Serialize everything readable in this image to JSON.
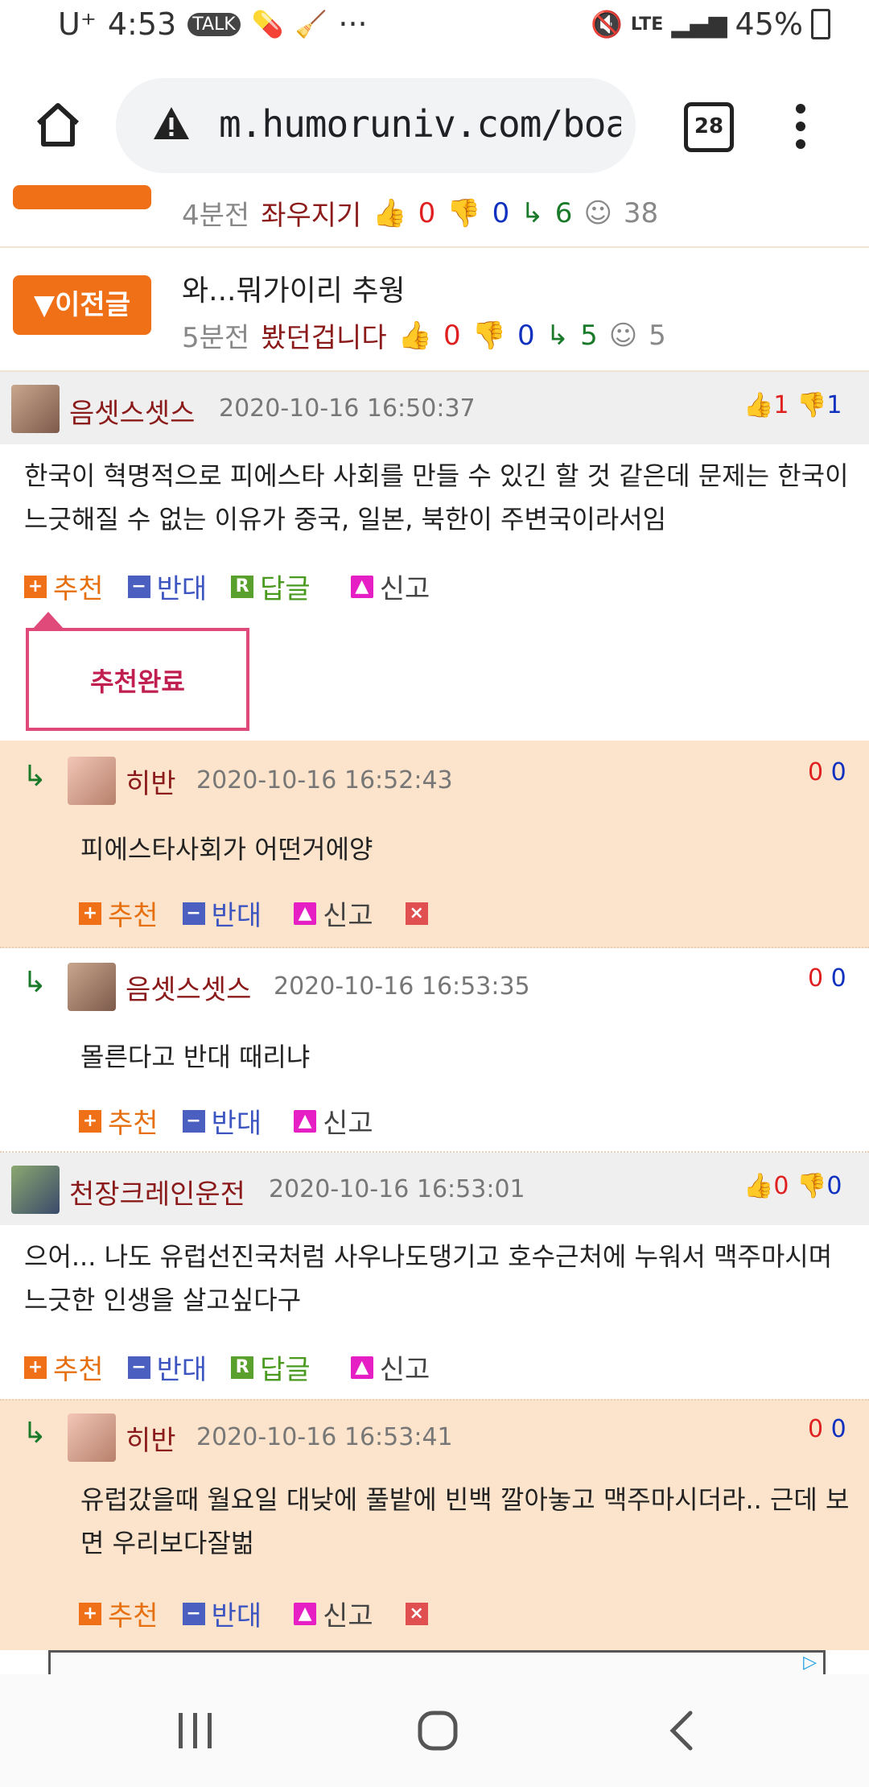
{
  "status_bar": {
    "carrier": "U⁺",
    "time": "4:53",
    "battery": "45%",
    "network": "LTE"
  },
  "browser": {
    "url": "m.humoruniv.com/boarc",
    "tab_count": "28"
  },
  "nav_rows": [
    {
      "time": "4분전",
      "author": "좌우지기",
      "up": "0",
      "down": "0",
      "replies": "6",
      "views": "38"
    },
    {
      "button_label": "▼이전글",
      "title": "와...뭐가이리 추웡",
      "time": "5분전",
      "author": "봤던겁니다",
      "up": "0",
      "down": "0",
      "replies": "5",
      "views": "5"
    }
  ],
  "comments": [
    {
      "author": "음셋스셋스",
      "date": "2020-10-16 16:50:37",
      "up": "1",
      "down": "1",
      "text": "한국이 혁명적으로 피에스타 사회를 만들 수 있긴 할 것 같은데 문제는 한국이 느긋해질 수 없는 이유가 중국, 일본, 북한이 주변국이라서임"
    },
    {
      "author": "천장크레인운전",
      "date": "2020-10-16 16:53:01",
      "up": "0",
      "down": "0",
      "text": "으어... 나도 유럽선진국처럼 사우나도댕기고 호수근처에 누워서 맥주마시며 느긋한 인생을 살고싶다구"
    }
  ],
  "replies": [
    {
      "author": "히반",
      "date": "2020-10-16 16:52:43",
      "up": "0",
      "down": "0",
      "text": "피에스타사회가 어떤거에양"
    },
    {
      "author": "음셋스셋스",
      "date": "2020-10-16 16:53:35",
      "up": "0",
      "down": "0",
      "text": "몰른다고 반대 때리냐"
    },
    {
      "author": "히반",
      "date": "2020-10-16 16:53:41",
      "up": "0",
      "down": "0",
      "text": "유럽갔을때 월요일 대낮에 풀밭에 빈백 깔아놓고 맥주마시더라.. 근데 보면 우리보다잘벎"
    }
  ],
  "actions": {
    "recommend": "추천",
    "oppose": "반대",
    "reply": "답글",
    "report": "신고"
  },
  "toast": {
    "text": "추천완료"
  },
  "colors": {
    "accent_orange": "#f07018",
    "reply_bg": "#fce4cc",
    "author_red": "#8b1a1a",
    "toast_pink": "#e04a7a"
  }
}
